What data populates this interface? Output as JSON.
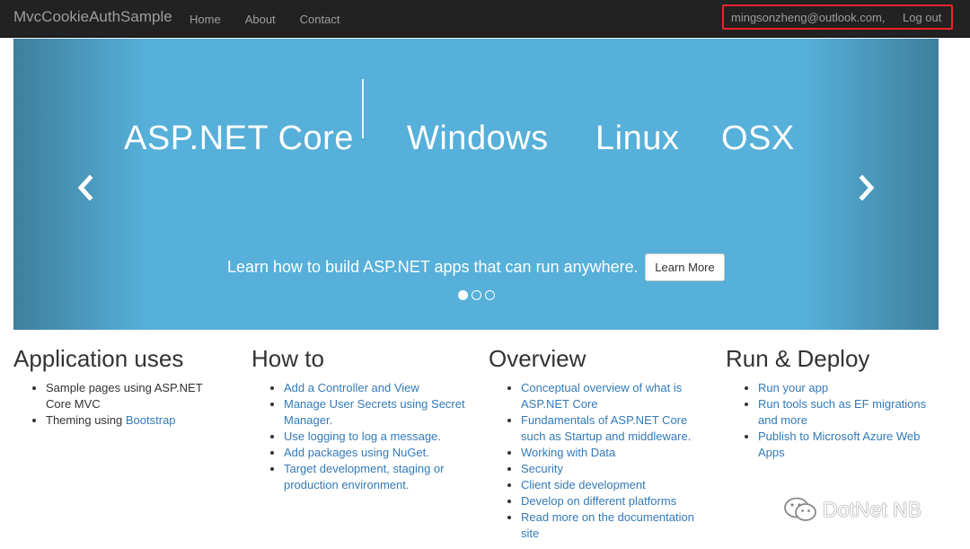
{
  "navbar": {
    "brand": "MvcCookieAuthSample",
    "links": [
      "Home",
      "About",
      "Contact"
    ],
    "email": "mingsonzheng@outlook.com,",
    "logout": "Log out"
  },
  "carousel": {
    "banner": [
      "ASP.NET Core",
      "Windows",
      "Linux",
      "OSX"
    ],
    "caption": "Learn how to build ASP.NET apps that can run anywhere.",
    "button": "Learn More",
    "active_slide": 1,
    "slide_count": 3
  },
  "sections": [
    {
      "title": "Application uses",
      "items": [
        {
          "text": "Sample pages using ASP.NET Core MVC"
        },
        {
          "text": "Theming using ",
          "link": "Bootstrap"
        }
      ]
    },
    {
      "title": "How to",
      "items": [
        {
          "link": "Add a Controller and View"
        },
        {
          "link": "Manage User Secrets using Secret Manager."
        },
        {
          "link": "Use logging to log a message."
        },
        {
          "link": "Add packages using NuGet."
        },
        {
          "link": "Target development, staging or production environment."
        }
      ]
    },
    {
      "title": "Overview",
      "items": [
        {
          "link": "Conceptual overview of what is ASP.NET Core"
        },
        {
          "link": "Fundamentals of ASP.NET Core such as Startup and middleware."
        },
        {
          "link": "Working with Data"
        },
        {
          "link": "Security"
        },
        {
          "link": "Client side development"
        },
        {
          "link": "Develop on different platforms"
        },
        {
          "link": "Read more on the documentation site"
        }
      ]
    },
    {
      "title": "Run & Deploy",
      "items": [
        {
          "link": "Run your app"
        },
        {
          "link": "Run tools such as EF migrations and more"
        },
        {
          "link": "Publish to Microsoft Azure Web Apps"
        }
      ]
    }
  ],
  "watermark": "DotNet NB",
  "colors": {
    "navbar_bg": "#222222",
    "carousel_bg": "#56b0d9",
    "link": "#337ab7",
    "highlight_box": "#e8262c"
  }
}
